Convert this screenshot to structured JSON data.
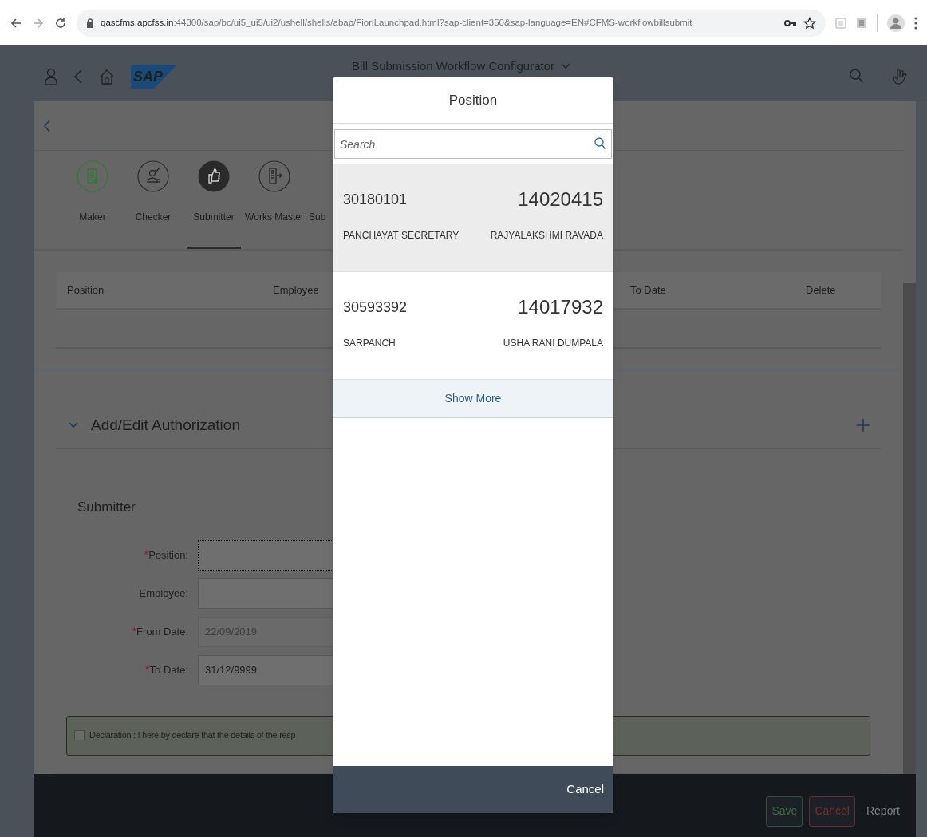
{
  "browser": {
    "url_host": "qascfms.apcfss.in",
    "url_rest": ":44300/sap/bc/ui5_ui5/ui2/ushell/shells/abap/FioriLaunchpad.html?sap-client=350&sap-language=EN#CFMS-workflowbillsubmit"
  },
  "shell": {
    "logo": "SAP",
    "title": "Bill Submission Workflow Configurator"
  },
  "tabs": [
    {
      "label": "Maker",
      "kind": "document",
      "color": "#2f7a2f",
      "selected": false
    },
    {
      "label": "Checker",
      "kind": "person-check",
      "color": "#2a2a2a",
      "selected": false
    },
    {
      "label": "Submitter",
      "kind": "thumb",
      "color": "#2a2a2a",
      "selected": true
    },
    {
      "label": "Works Master",
      "kind": "building",
      "color": "#2a2a2a",
      "selected": false
    },
    {
      "label": "Sub",
      "selected": false
    }
  ],
  "table": {
    "columns": [
      "Position",
      "Employee",
      "To Date",
      "Delete"
    ]
  },
  "panel": {
    "title": "Add/Edit Authorization",
    "expanded": true,
    "section": "Submitter",
    "fields": [
      {
        "marker": "*",
        "label": "Position:",
        "disabled": false,
        "focused": true
      },
      {
        "label": "Employee:",
        "disabled": false,
        "focused": false
      },
      {
        "marker": "*",
        "label": "From Date:",
        "value": "22/09/2019",
        "disabled": true,
        "focused": false
      },
      {
        "marker": "*",
        "label": "To Date:",
        "value": "31/12/9999",
        "disabled": false,
        "focused": false
      }
    ],
    "declaration": {
      "text": "Declaration : I here by declare that the details of the resp",
      "checked": false
    }
  },
  "footer": {
    "buttons": [
      {
        "label": "Save",
        "kind": "save"
      },
      {
        "label": "Cancel",
        "kind": "cancel"
      },
      {
        "label": "Report",
        "kind": "plain"
      }
    ]
  },
  "dialog": {
    "title": "Position",
    "search_placeholder": "Search",
    "items": [
      {
        "code": "30180101",
        "number": "14020415",
        "designation": "PANCHAYAT SECRETARY",
        "name": "RAJYALAKSHMI RAVADA",
        "selected": true
      },
      {
        "code": "30593392",
        "number": "14017932",
        "designation": "SARPANCH",
        "name": "USHA RANI DUMPALA",
        "selected": false
      }
    ],
    "more": "Show More",
    "cancel": "Cancel"
  }
}
